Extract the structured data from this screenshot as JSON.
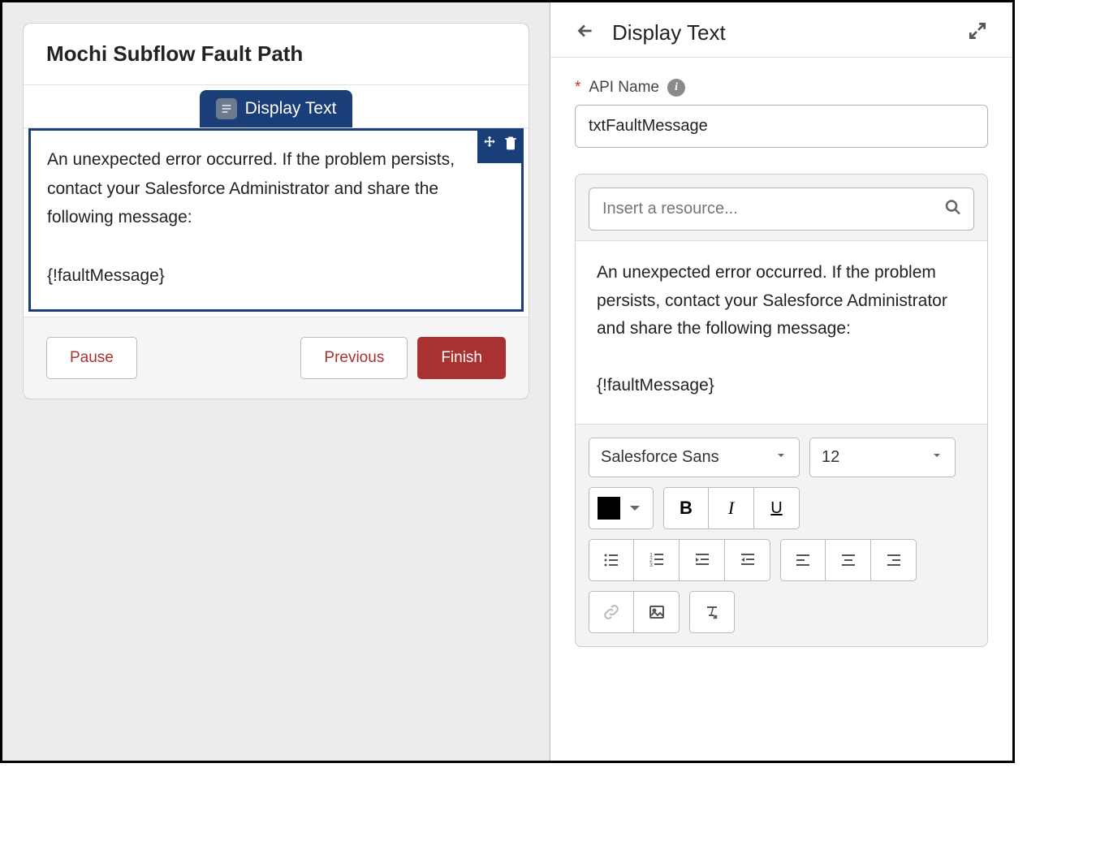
{
  "left": {
    "title": "Mochi Subflow Fault Path",
    "tab_label": "Display Text",
    "message_line1": "An unexpected error occurred. If the problem persists, contact your Salesforce Administrator and share the following message:",
    "message_token": "{!faultMessage}",
    "buttons": {
      "pause": "Pause",
      "previous": "Previous",
      "finish": "Finish"
    }
  },
  "right": {
    "panel_title": "Display Text",
    "api_name_label": "API Name",
    "api_name_value": "txtFaultMessage",
    "resource_placeholder": "Insert a resource...",
    "editor_line1": "An unexpected error occurred. If the problem persists, contact your Salesforce Administrator and share the following message:",
    "editor_token": "{!faultMessage}",
    "font_family": "Salesforce Sans",
    "font_size": "12"
  }
}
